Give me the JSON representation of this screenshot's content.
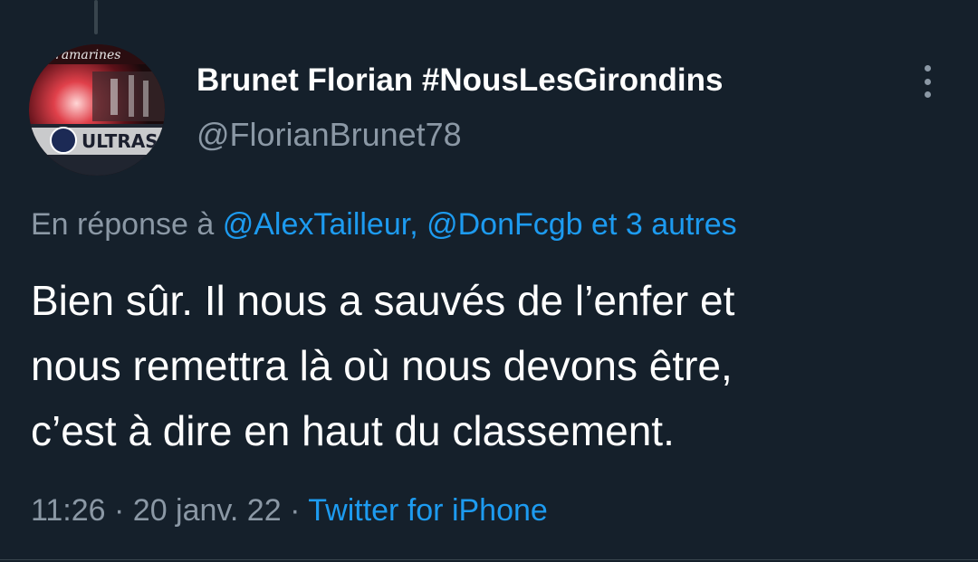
{
  "tweet": {
    "author": {
      "display_name": "Brunet Florian #NousLesGirondins",
      "handle": "@FlorianBrunet78",
      "avatar_text": "ultramarines"
    },
    "more_icon": "more-options-icon",
    "reply_context": {
      "prefix": "En réponse à ",
      "mention_1": "@AlexTailleur,",
      "mention_2": "@DonFcgb",
      "suffix": "et 3 autres"
    },
    "text_lines": [
      "Bien sûr. Il nous a sauvés de l’enfer et",
      "nous remettra là où nous devons être,",
      "c’est à dire en haut du classement."
    ],
    "time": "11:26",
    "date": "20 janv. 22",
    "separator": "·",
    "source": "Twitter for iPhone"
  },
  "colors": {
    "background": "#15202b",
    "text_primary": "#ffffff",
    "text_secondary": "#8b98a5",
    "accent": "#1d9bf0"
  }
}
